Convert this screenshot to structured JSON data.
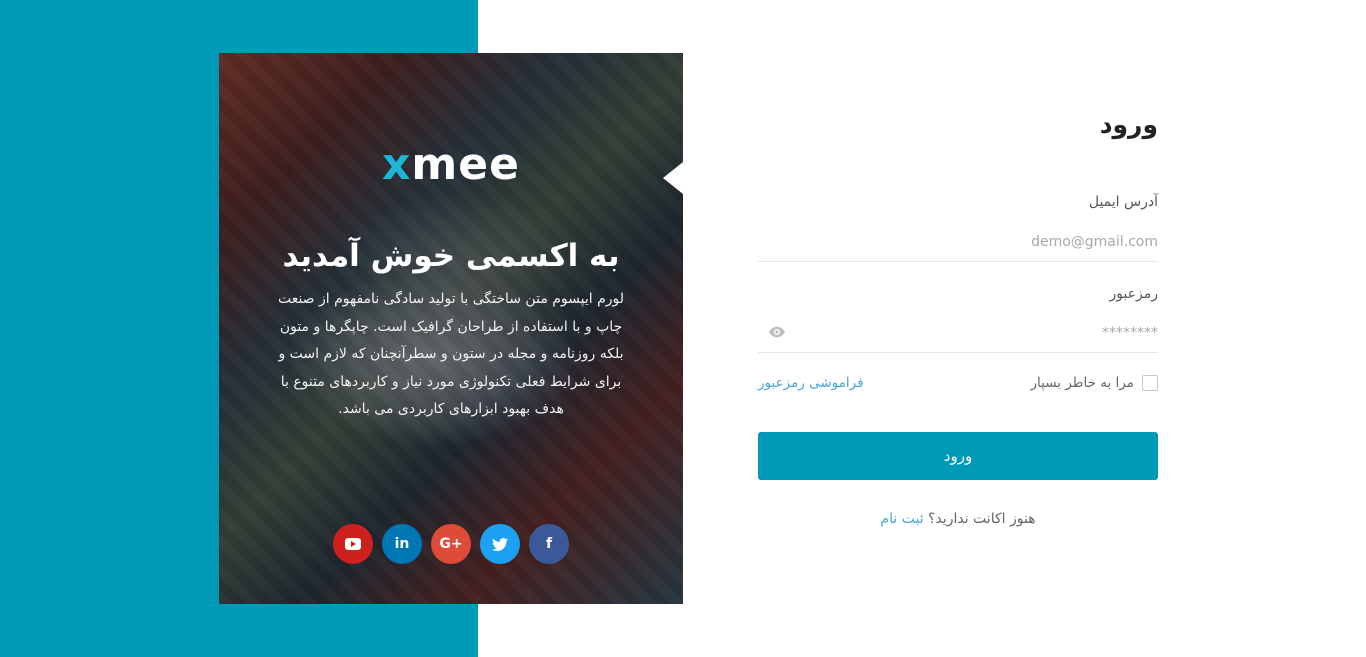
{
  "hero": {
    "logo_x": "x",
    "logo_rest": "mee",
    "welcome": "به اکسمی خوش آمدید",
    "description": "لورم ایپسوم متن ساختگی با تولید سادگی نامفهوم از صنعت چاپ و با استفاده از طراحان گرافیک است. چاپگرها و متون بلکه روزنامه و مجله در ستون و سطرآنچنان که لازم است و برای شرایط فعلی تکنولوژی مورد نیاز و کاربردهای متنوع با هدف بهبود ابزارهای کاربردی می باشد.",
    "socials": [
      {
        "icon": "facebook-icon",
        "glyph": "f",
        "color": "#3b5998"
      },
      {
        "icon": "twitter-icon",
        "glyph": "",
        "color": "#1da1f2"
      },
      {
        "icon": "google-plus-icon",
        "glyph": "G+",
        "color": "#dd4b39"
      },
      {
        "icon": "linkedin-icon",
        "glyph": "in",
        "color": "#0077b5"
      },
      {
        "icon": "youtube-icon",
        "glyph": "",
        "color": "#cd201f"
      }
    ]
  },
  "form": {
    "title": "ورود",
    "email_label": "آدرس ایمیل",
    "email_placeholder": "demo@gmail.com",
    "password_label": "رمزعبور",
    "password_placeholder": "********",
    "remember_label": "مرا به خاطر بسپار",
    "forgot_link": "فراموشی رمزعبور",
    "submit_label": "ورود",
    "signup_prompt": "هنوز اکانت ندارید؟",
    "signup_link": "ثبت نام"
  },
  "colors": {
    "accent": "#0099b8",
    "link": "#4aa3d9"
  }
}
